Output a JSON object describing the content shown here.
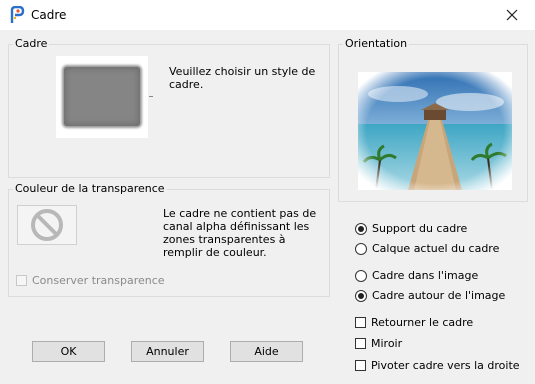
{
  "window": {
    "title": "Cadre"
  },
  "frame_group": {
    "label": "Cadre",
    "instruction": "Veuillez choisir un style de cadre."
  },
  "transparency_group": {
    "label": "Couleur de la transparence",
    "message": "Le cadre ne contient pas de canal alpha définissant les zones transparentes à remplir de couleur.",
    "keep_transparency": {
      "label": "Conserver transparence",
      "checked": false,
      "enabled": false
    }
  },
  "orientation_group": {
    "label": "Orientation",
    "options": [
      {
        "label": "Support du cadre",
        "selected": true
      },
      {
        "label": "Calque actuel du cadre",
        "selected": false
      },
      {
        "label": "Cadre dans l'image",
        "selected": false
      },
      {
        "label": "Cadre autour de l'image",
        "selected": true
      }
    ],
    "checks": [
      {
        "label": "Retourner le cadre",
        "checked": false
      },
      {
        "label": "Miroir",
        "checked": false
      },
      {
        "label": "Pivoter cadre vers la droite",
        "checked": false
      }
    ]
  },
  "buttons": {
    "ok": "OK",
    "cancel": "Annuler",
    "help": "Aide"
  },
  "icons": {
    "app": "paintshop-pro-icon",
    "close": "close-icon",
    "no_alpha": "prohibited-icon"
  }
}
